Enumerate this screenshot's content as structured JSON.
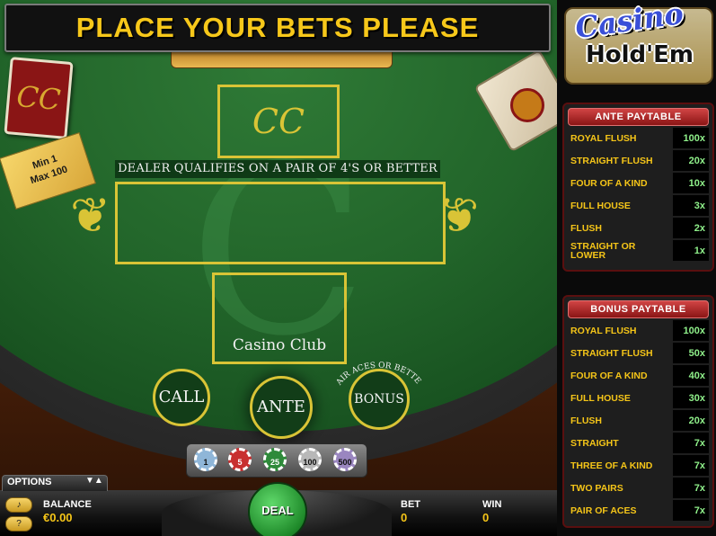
{
  "header": {
    "title": "PLACE YOUR BETS PLEASE"
  },
  "table": {
    "deck_logo": "CC",
    "dealer_logo": "CC",
    "watermark": "C",
    "qualify_text": "DEALER QUALIFIES ON A PAIR OF 4'S OR BETTER",
    "player_box_label": "Casino Club",
    "limits": {
      "min": "Min 1",
      "max": "Max 100"
    },
    "circles": {
      "call": "CALL",
      "ante": "ANTE",
      "bonus": "BONUS",
      "bonus_arc": "PAIR ACES OR BETTER"
    }
  },
  "chips": [
    "1",
    "5",
    "25",
    "100",
    "500"
  ],
  "bottom": {
    "options_label": "OPTIONS",
    "options_arrows": "▼▲",
    "balance_label": "BALANCE",
    "balance_value": "€0.00",
    "deal_label": "DEAL",
    "bet_label": "BET",
    "bet_value": "0",
    "win_label": "WIN",
    "win_value": "0",
    "sound_icon": "speaker-icon",
    "help_icon": "question-icon"
  },
  "brand": {
    "line1": "Casino",
    "line2": "Hold'Em"
  },
  "ante_paytable": {
    "title": "ANTE PAYTABLE",
    "rows": [
      {
        "hand": "ROYAL FLUSH",
        "pay": "100x"
      },
      {
        "hand": "STRAIGHT FLUSH",
        "pay": "20x"
      },
      {
        "hand": "FOUR OF A KIND",
        "pay": "10x"
      },
      {
        "hand": "FULL HOUSE",
        "pay": "3x"
      },
      {
        "hand": "FLUSH",
        "pay": "2x"
      },
      {
        "hand": "STRAIGHT OR LOWER",
        "pay": "1x"
      }
    ]
  },
  "bonus_paytable": {
    "title": "BONUS PAYTABLE",
    "rows": [
      {
        "hand": "ROYAL FLUSH",
        "pay": "100x"
      },
      {
        "hand": "STRAIGHT FLUSH",
        "pay": "50x"
      },
      {
        "hand": "FOUR OF A KIND",
        "pay": "40x"
      },
      {
        "hand": "FULL HOUSE",
        "pay": "30x"
      },
      {
        "hand": "FLUSH",
        "pay": "20x"
      },
      {
        "hand": "STRAIGHT",
        "pay": "7x"
      },
      {
        "hand": "THREE OF A KIND",
        "pay": "7x"
      },
      {
        "hand": "TWO PAIRS",
        "pay": "7x"
      },
      {
        "hand": "PAIR OF ACES",
        "pay": "7x"
      }
    ]
  },
  "colors": {
    "accent": "#f5c518",
    "felt": "#22652a",
    "paytable_header": "#b82020",
    "pay_value": "#8ff08a"
  }
}
